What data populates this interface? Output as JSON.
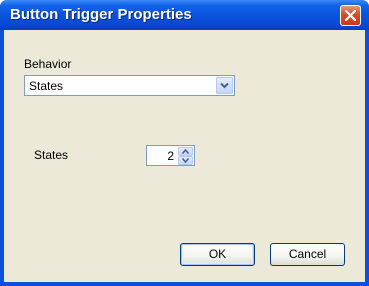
{
  "window": {
    "title": "Button Trigger Properties"
  },
  "behavior": {
    "label": "Behavior",
    "selected": "States"
  },
  "states": {
    "label": "States",
    "value": "2"
  },
  "buttons": {
    "ok": "OK",
    "cancel": "Cancel"
  },
  "icons": {
    "close": "close-icon",
    "dropdown": "chevron-down-icon",
    "spin_up": "spin-up-icon",
    "spin_down": "spin-down-icon"
  },
  "colors": {
    "titlebar": "#0a52dc",
    "client": "#ece9d8",
    "close_button": "#d8502c"
  }
}
